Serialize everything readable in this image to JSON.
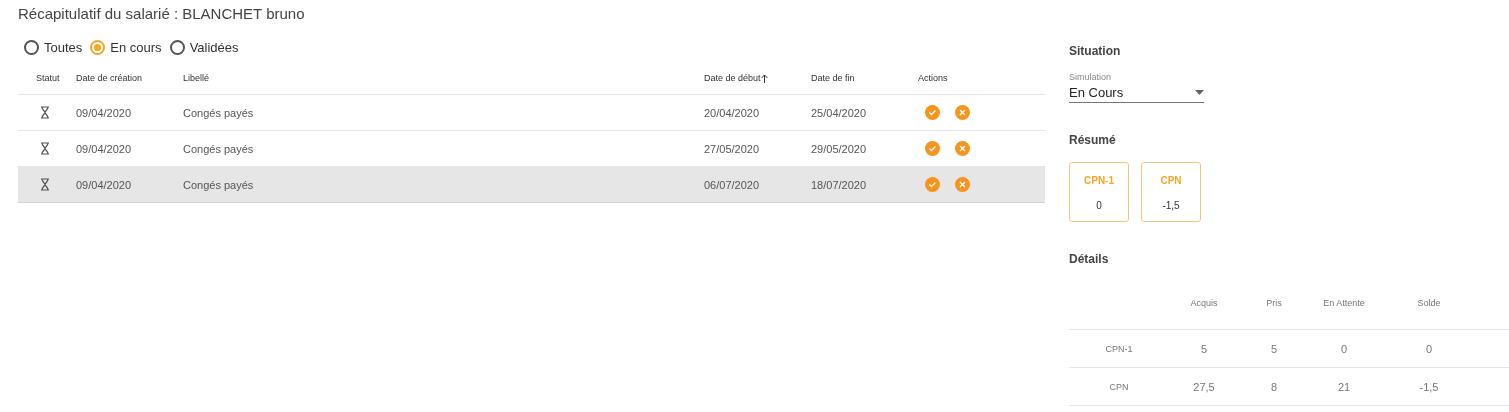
{
  "title": "Récapitulatif du salarié : BLANCHET bruno",
  "filters": [
    {
      "label": "Toutes",
      "selected": false
    },
    {
      "label": "En cours",
      "selected": true
    },
    {
      "label": "Validées",
      "selected": false
    }
  ],
  "table": {
    "columns": [
      {
        "label": "Statut",
        "sorted": false
      },
      {
        "label": "Date de création",
        "sorted": false
      },
      {
        "label": "Libellé",
        "sorted": false
      },
      {
        "label": "Date de début",
        "sorted": true
      },
      {
        "label": "Date de fin",
        "sorted": false
      },
      {
        "label": "Actions",
        "sorted": false
      }
    ],
    "rows": [
      {
        "created": "09/04/2020",
        "label": "Congés payés",
        "start": "20/04/2020",
        "end": "25/04/2020",
        "highlighted": false
      },
      {
        "created": "09/04/2020",
        "label": "Congés payés",
        "start": "27/05/2020",
        "end": "29/05/2020",
        "highlighted": false
      },
      {
        "created": "09/04/2020",
        "label": "Congés payés",
        "start": "06/07/2020",
        "end": "18/07/2020",
        "highlighted": true
      }
    ]
  },
  "situation": {
    "heading": "Situation",
    "field_label": "Simulation",
    "value": "En Cours"
  },
  "summary": {
    "heading": "Résumé",
    "cards": [
      {
        "title": "CPN-1",
        "value": "0"
      },
      {
        "title": "CPN",
        "value": "-1,5"
      }
    ]
  },
  "details": {
    "heading": "Détails",
    "columns": [
      "Acquis",
      "Pris",
      "En Attente",
      "Solde"
    ],
    "rows": [
      {
        "label": "CPN-1",
        "values": [
          "5",
          "5",
          "0",
          "0"
        ]
      },
      {
        "label": "CPN",
        "values": [
          "27,5",
          "8",
          "21",
          "-1,5"
        ]
      }
    ]
  }
}
